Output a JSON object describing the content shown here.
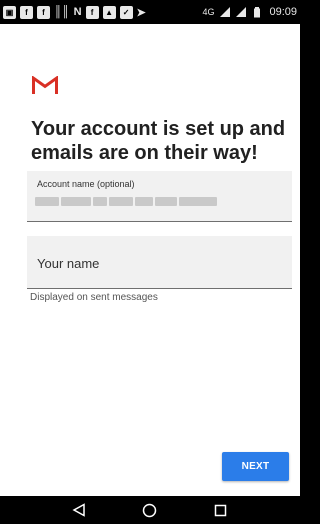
{
  "status_bar": {
    "notification_icons": [
      "gallery-icon",
      "facebook-icon",
      "facebook-icon",
      "stats-icon",
      "n-icon",
      "facebook-icon",
      "image-icon",
      "app-check-icon",
      "send-icon"
    ],
    "network": "4G",
    "time": "09:09"
  },
  "app": {
    "logo": "gmail-m-logo",
    "brand_color": "#d93025"
  },
  "setup": {
    "headline": "Your account is set up and emails are on their way!",
    "account_name_label": "Account name (optional)",
    "account_name_value_hidden": true,
    "your_name_placeholder": "Your name",
    "your_name_helper": "Displayed on sent messages"
  },
  "actions": {
    "next_label": "NEXT",
    "next_color": "#2b7de9"
  },
  "nav": {
    "items": [
      "back-icon",
      "home-icon",
      "recents-icon"
    ]
  }
}
